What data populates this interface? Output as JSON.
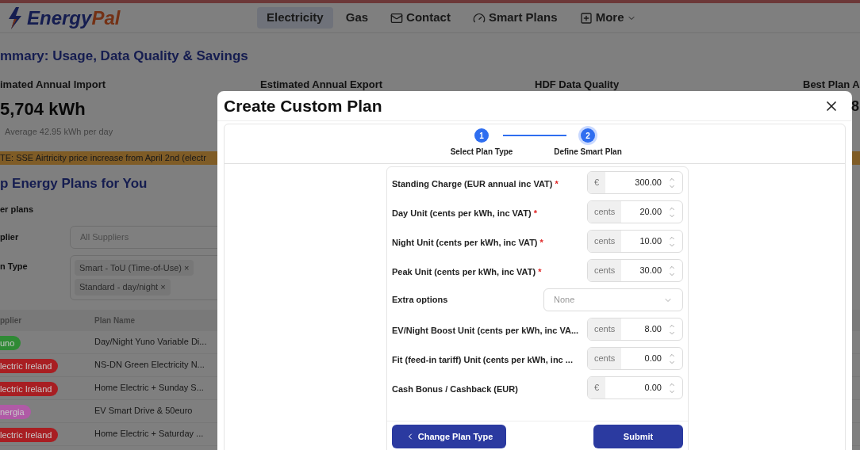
{
  "header": {
    "logo": [
      "Energy",
      "Pal"
    ],
    "nav": [
      {
        "label": "Electricity",
        "selected": true,
        "kind": "plain",
        "dropdown": false
      },
      {
        "label": "Gas",
        "selected": false,
        "kind": "plain",
        "dropdown": false
      },
      {
        "label": "Contact",
        "selected": false,
        "kind": "mail",
        "dropdown": false
      },
      {
        "label": "Smart Plans",
        "selected": false,
        "kind": "gauge",
        "dropdown": false
      },
      {
        "label": "More",
        "selected": false,
        "kind": "plus",
        "dropdown": true
      }
    ]
  },
  "summary": {
    "title": "mmary: Usage, Data Quality & Savings",
    "stats": [
      {
        "label": "imated Annual Import",
        "value": "5,704 kWh",
        "note": "Average 42.95 kWh per day"
      },
      {
        "label": "Estimated Annual Export"
      },
      {
        "label": "HDF Data Quality"
      },
      {
        "label": "Best Plan A",
        "value": "8"
      }
    ]
  },
  "notice": "TE: SSE Airtricity price increase from April 2nd (electr",
  "plans": {
    "title": "p Energy Plans for You",
    "filter_heading": "er plans",
    "filters": [
      {
        "label": "plier",
        "placeholder": "All Suppliers"
      },
      {
        "label": "n Type",
        "tags": [
          {
            "label": "Smart - ToU (Time-of-Use)",
            "remove": "×"
          },
          {
            "label": "Standard - day/night",
            "remove": "×"
          }
        ]
      }
    ],
    "columns": [
      "pplier",
      "Plan Name"
    ],
    "rows": [
      {
        "supplier": "uno",
        "color": "#2f8a35",
        "plan": "Day/Night Yuno Variable Di..."
      },
      {
        "supplier": "lectric Ireland",
        "color": "#a81e22",
        "plan": "NS-DN Green Electricity N..."
      },
      {
        "supplier": "lectric Ireland",
        "color": "#a81e22",
        "plan": "Home Electric + Sunday S..."
      },
      {
        "supplier": "nergia",
        "color": "#b05aa6",
        "plan": "EV Smart Drive & 50euro"
      },
      {
        "supplier": "lectric Ireland",
        "color": "#a81e22",
        "plan": "Home Electric + Saturday ..."
      }
    ]
  },
  "modal": {
    "title": "Create Custom Plan",
    "steps": [
      {
        "number": "1",
        "label": "Select Plan Type",
        "selected": false
      },
      {
        "number": "2",
        "label": "Define Smart Plan",
        "selected": true
      }
    ],
    "fields": [
      {
        "kind": "number",
        "label": "Standing Charge (EUR annual inc VAT)",
        "required_mark": "*",
        "unit": "€",
        "value": "300.00"
      },
      {
        "kind": "number",
        "label": "Day Unit (cents per kWh, inc VAT)",
        "required_mark": "*",
        "unit": "cents",
        "value": "20.00"
      },
      {
        "kind": "number",
        "label": "Night Unit (cents per kWh, inc VAT)",
        "required_mark": "*",
        "unit": "cents",
        "value": "10.00"
      },
      {
        "kind": "number",
        "label": "Peak Unit (cents per kWh, inc VAT)",
        "required_mark": "*",
        "unit": "cents",
        "value": "30.00"
      },
      {
        "kind": "select",
        "label": "Extra options",
        "placeholder": "None"
      },
      {
        "kind": "number",
        "label": "EV/Night Boost Unit (cents per kWh, inc VA...",
        "unit": "cents",
        "value": "8.00"
      },
      {
        "kind": "number",
        "label": "Fit (feed-in tariff) Unit (cents per kWh, inc ...",
        "unit": "cents",
        "value": "0.00"
      },
      {
        "kind": "number",
        "label": "Cash Bonus / Cashback (EUR)",
        "unit": "€",
        "value": "0.00"
      }
    ],
    "back_button": "Change Plan Type",
    "submit_button": "Submit"
  }
}
